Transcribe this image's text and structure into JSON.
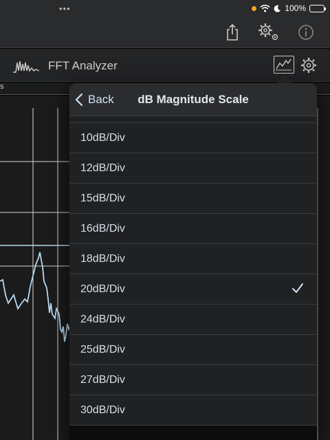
{
  "status_bar": {
    "dots": "•••",
    "battery": "100%",
    "battery_level": 1.0,
    "accent": "#f5a623"
  },
  "toolbar": {
    "share_icon": "share-icon",
    "settings_icon": "settings-gear-icon",
    "info_icon": "info-icon"
  },
  "titlebar": {
    "title": "FFT Analyzer",
    "spectrum_icon": "spectrum-icon",
    "graph_icon": "graph-icon",
    "gear_icon": "gear-icon"
  },
  "plot_header": {
    "label": "s"
  },
  "popover": {
    "back_label": "Back",
    "title": "dB Magnitude Scale",
    "options": [
      {
        "label": "10dB/Div",
        "selected": false
      },
      {
        "label": "12dB/Div",
        "selected": false
      },
      {
        "label": "15dB/Div",
        "selected": false
      },
      {
        "label": "16dB/Div",
        "selected": false
      },
      {
        "label": "18dB/Div",
        "selected": false
      },
      {
        "label": "20dB/Div",
        "selected": true
      },
      {
        "label": "24dB/Div",
        "selected": false
      },
      {
        "label": "25dB/Div",
        "selected": false
      },
      {
        "label": "27dB/Div",
        "selected": false
      },
      {
        "label": "30dB/Div",
        "selected": false
      }
    ]
  },
  "colors": {
    "trace": "#b9d9ee",
    "grid": "#d8d8d8",
    "accent_text": "#cfe3f7"
  }
}
